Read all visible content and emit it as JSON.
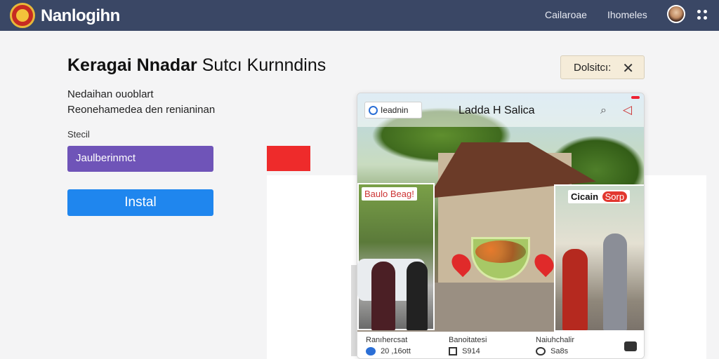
{
  "header": {
    "brand": "Nanlogihn",
    "nav": [
      "Cailaroae",
      "Ihomeles"
    ],
    "icons": [
      "logo-icon",
      "avatar",
      "apps-icon"
    ]
  },
  "main": {
    "title_bold": "Keragai Nnadar",
    "title_thin": "Sutcı Kurnndins",
    "subtitle1": "Nedaihan ouoblart",
    "subtitle2": "Reonehamedea den renianinan",
    "field_label": "Stecil",
    "select_value": "Jaulberinmct",
    "install_label": "Instal",
    "details_label": "Dolsitcı:"
  },
  "card": {
    "badge": "Ieadnin",
    "title": "Ladda H Salica",
    "label_left": "Baulo Beag!",
    "label_right": "Cicain",
    "label_right_tag": "Sorp",
    "footer": {
      "col1_top": "Ranıhercsat",
      "col1_bottom": "20 ,16ott",
      "col2_top": "Banoitatesi",
      "col2_bottom": "S914",
      "col3_top": "Naiuhchalir",
      "col3_bottom": "Sa8s"
    }
  },
  "colors": {
    "topbar": "#3a4765",
    "select": "#6f54b8",
    "install": "#1f86ee",
    "details": "#f5ecd9",
    "accent_red": "#ee2b2b"
  }
}
